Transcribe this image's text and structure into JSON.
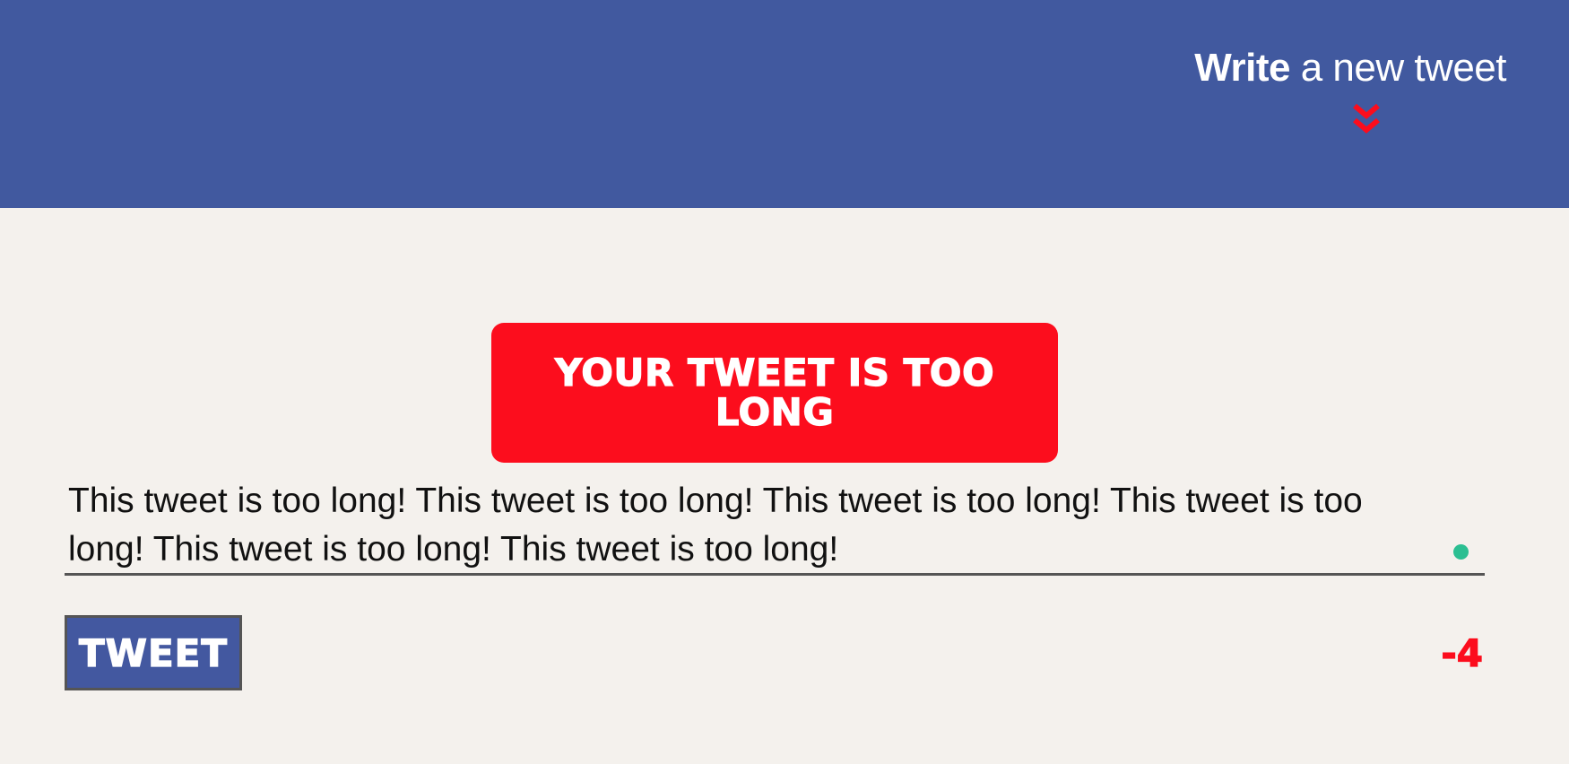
{
  "header": {
    "compose_bold": "Write",
    "compose_rest": " a new tweet"
  },
  "error": {
    "message": "Your tweet is too long"
  },
  "composer": {
    "text": "This tweet is too long! This tweet is too long! This tweet is too long! This tweet is too long! This tweet is too long! This tweet is too long!"
  },
  "actions": {
    "tweet_label": "TWEET"
  },
  "counter": {
    "remaining": "-4"
  },
  "colors": {
    "header_bg": "#41599f",
    "page_bg": "#f4f1ed",
    "error_red": "#fc0d1d",
    "status_dot": "#2bbf92",
    "button_bg": "#4358a0"
  },
  "icons": {
    "compose_toggle": "double-chevron-down-icon",
    "status": "status-dot-icon"
  }
}
